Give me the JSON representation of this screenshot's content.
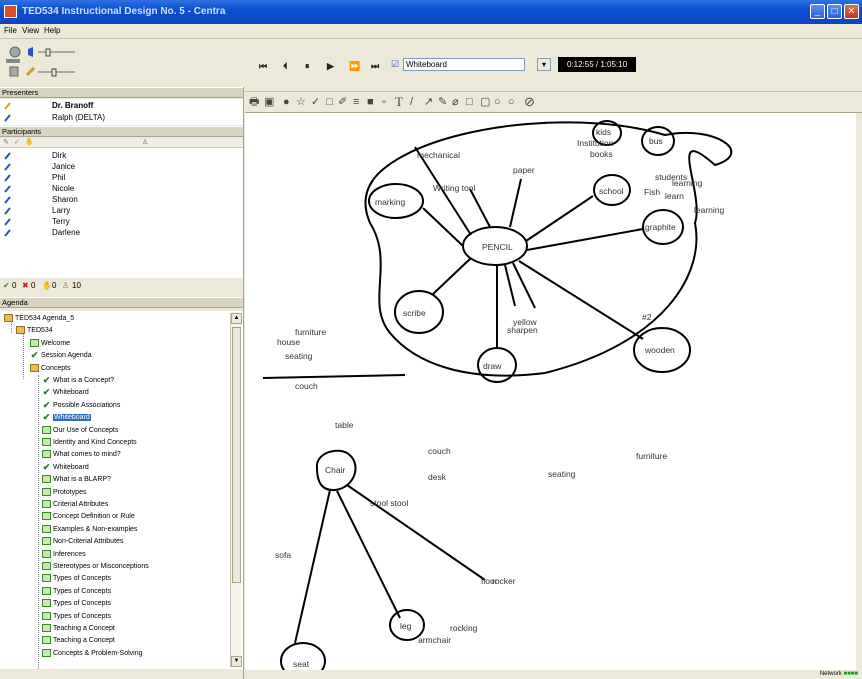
{
  "window": {
    "title": "TED534 Instructional Design No. 5 - Centra",
    "buttons": [
      "_",
      "□",
      "✕"
    ]
  },
  "menu": [
    "File",
    "View",
    "Help"
  ],
  "presenters": {
    "header": "Presenters",
    "people": [
      "Dr. Branoff",
      "Ralph (DELTA)"
    ]
  },
  "participants": {
    "header": "Participants",
    "people": [
      "Dirk",
      "Janice",
      "Phil",
      "Nicole",
      "Sharon",
      "Larry",
      "Terry",
      "Darlene"
    ]
  },
  "counts": {
    "yes": "0",
    "no": "0",
    "raised": "0",
    "total": "10"
  },
  "agenda": {
    "header": "Agenda",
    "items": [
      {
        "label": "TED534 Agenda_5",
        "indent": 0,
        "icon": "folder"
      },
      {
        "label": "TED534",
        "indent": 1,
        "icon": "folder"
      },
      {
        "label": "Welcome",
        "indent": 2,
        "icon": "page"
      },
      {
        "label": "Session Agenda",
        "indent": 2,
        "icon": "check"
      },
      {
        "label": "Concepts",
        "indent": 2,
        "icon": "folder"
      },
      {
        "label": "What is a Concept?",
        "indent": 3,
        "icon": "check"
      },
      {
        "label": "Whiteboard",
        "indent": 3,
        "icon": "check"
      },
      {
        "label": "Possible Associations",
        "indent": 3,
        "icon": "check"
      },
      {
        "label": "Whiteboard",
        "indent": 3,
        "icon": "check",
        "selected": true
      },
      {
        "label": "Our Use of Concepts",
        "indent": 3,
        "icon": "page"
      },
      {
        "label": "Identity and Kind Concepts",
        "indent": 3,
        "icon": "page"
      },
      {
        "label": "What comes to mind?",
        "indent": 3,
        "icon": "page"
      },
      {
        "label": "Whiteboard",
        "indent": 3,
        "icon": "check"
      },
      {
        "label": "What is a BLARP?",
        "indent": 3,
        "icon": "page"
      },
      {
        "label": "Prototypes",
        "indent": 3,
        "icon": "page"
      },
      {
        "label": "Criterial Attributes",
        "indent": 3,
        "icon": "page"
      },
      {
        "label": "Concept Definition or Rule",
        "indent": 3,
        "icon": "page"
      },
      {
        "label": "Examples & Non-examples",
        "indent": 3,
        "icon": "page"
      },
      {
        "label": "Non-Criterial Attributes",
        "indent": 3,
        "icon": "page"
      },
      {
        "label": "Inferences",
        "indent": 3,
        "icon": "page"
      },
      {
        "label": "Stereotypes or Misconceptions",
        "indent": 3,
        "icon": "page"
      },
      {
        "label": "Types of Concepts",
        "indent": 3,
        "icon": "page"
      },
      {
        "label": "Types of Concepts",
        "indent": 3,
        "icon": "page"
      },
      {
        "label": "Types of Concepts",
        "indent": 3,
        "icon": "page"
      },
      {
        "label": "Types of Concepts",
        "indent": 3,
        "icon": "page"
      },
      {
        "label": "Teaching a Concept",
        "indent": 3,
        "icon": "page"
      },
      {
        "label": "Teaching a Concept",
        "indent": 3,
        "icon": "page"
      },
      {
        "label": "Concepts & Problem-Solving",
        "indent": 3,
        "icon": "page"
      }
    ]
  },
  "media": {
    "buttons": [
      "⏮",
      "⏴",
      "⏸",
      "▶",
      "⏩",
      "⏭"
    ],
    "selected_tool": "Whiteboard",
    "time": "0:12:55 / 1:05:10"
  },
  "toolbar_icons": [
    "print-icon",
    "save-icon",
    "dot-icon",
    "star-icon",
    "check-icon",
    "rect-select-icon",
    "pencil-icon",
    "lines-icon",
    "fill-icon",
    "color-icon",
    "text-icon",
    "line-icon",
    "arrow-icon",
    "pen-icon",
    "eraser-icon",
    "rectangle-icon",
    "rounded-rect-icon",
    "ellipse-icon",
    "circle-icon",
    "no-icon"
  ],
  "whiteboard": {
    "words": [
      "PENCIL",
      "mechanical",
      "paper",
      "Writing tool",
      "marking",
      "school",
      "bus",
      "Institution",
      "books",
      "kids",
      "students",
      "Fish",
      "learning",
      "learn",
      "learning",
      "graphite",
      "scribe",
      "yellow",
      "sharpen",
      "draw",
      "#2",
      "wooden",
      "furniture",
      "house",
      "seating",
      "couch",
      "table",
      "couch",
      "desk",
      "seating",
      "furniture",
      "Chair",
      "stool stool",
      "sofa",
      "floor",
      "rocker",
      "leg",
      "rocking",
      "armchair",
      "seat"
    ]
  },
  "status": {
    "network": "Network"
  }
}
